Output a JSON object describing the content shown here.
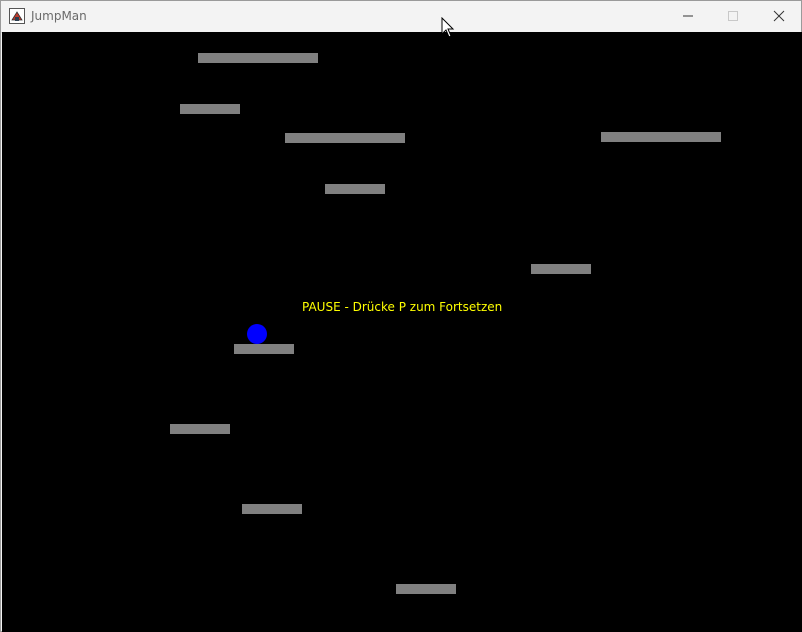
{
  "window": {
    "title": "JumpMan",
    "app_icon": "java-app-icon",
    "controls": {
      "minimize_icon": "minimize-icon",
      "maximize_icon": "maximize-icon",
      "close_icon": "close-icon"
    }
  },
  "game": {
    "background_color": "#000000",
    "platform_color": "#808080",
    "player_color": "#0000ff",
    "pause_color": "#ffff00",
    "pause_message": "PAUSE - Drücke P zum Fortsetzen"
  }
}
